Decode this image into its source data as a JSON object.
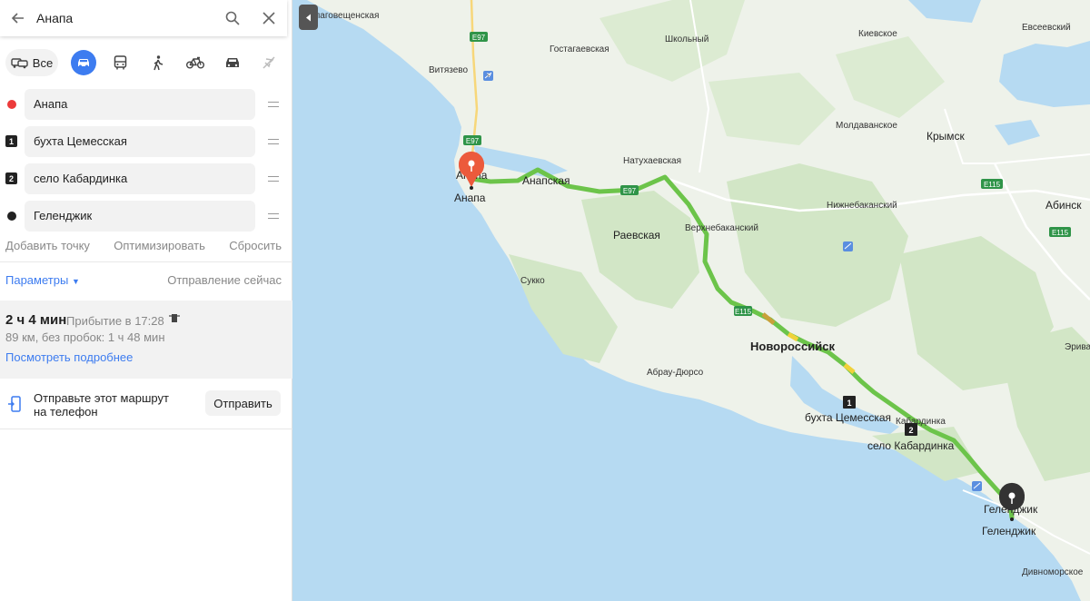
{
  "search": {
    "query": "Анапа"
  },
  "modes": {
    "all_label": "Все"
  },
  "points": [
    {
      "marker": "",
      "name": "Анапа"
    },
    {
      "marker": "1",
      "name": "бухта Цемесская"
    },
    {
      "marker": "2",
      "name": "село Кабардинка"
    },
    {
      "marker": "",
      "name": "Геленджик"
    }
  ],
  "point_actions": {
    "add": "Добавить точку",
    "optimize": "Оптимизировать",
    "reset": "Сбросить"
  },
  "params": {
    "label": "Параметры",
    "departure": "Отправление сейчас"
  },
  "route": {
    "duration": "2 ч 4 мин",
    "arrival": "Прибытие в 17:28",
    "distance": "89 км, без пробок: 1 ч 48 мин",
    "details_link": "Посмотреть подробнее"
  },
  "send": {
    "text": "Отправьте этот маршрут на телефон",
    "button": "Отправить"
  },
  "colors": {
    "accent": "#3d7cf0",
    "route": "#6cc44a",
    "start_pin": "#ec5a3c",
    "water": "#b6daf2",
    "land": "#eef2ea"
  },
  "map": {
    "labels": {
      "blagoveshchenskaya": "Благовещенская",
      "vityazevo": "Витязево",
      "gostagaevskaya": "Гостагаевская",
      "shkolny": "Школьный",
      "kievskoe": "Киевское",
      "evseevsky": "Евсеевский",
      "moldavanskoe": "Молдаванское",
      "krymsk": "Крымск",
      "natukhaevskaya": "Натухаевская",
      "anapskaya": "Анапская",
      "anapa_top": "Анапа",
      "anapa_bottom": "Анапа",
      "nizhnebakansky": "Нижнебаканский",
      "abinsk": "Абинск",
      "verkhnebakansky": "Верхнебаканский",
      "raevskaya": "Раевская",
      "sukko": "Сукко",
      "novorossiysk": "Новороссийск",
      "erivan": "Эриван",
      "abrau_durso": "Абрау-Дюрсо",
      "bukhta": "бухта Цемесская",
      "kabardinka_small": "Кабардинка",
      "kabardinka": "село Кабардинка",
      "gelendzhik_1": "Геленджик",
      "gelendzhik_2": "Геленджик",
      "divnomorskoe": "Дивноморское"
    },
    "road_signs": {
      "e97_top": "E97",
      "e97_mid": "E97",
      "e115_a": "E115",
      "e115_b": "E115",
      "e115_c": "E115",
      "m25": "E97"
    },
    "markers": {
      "m1": "1",
      "m2": "2"
    }
  }
}
